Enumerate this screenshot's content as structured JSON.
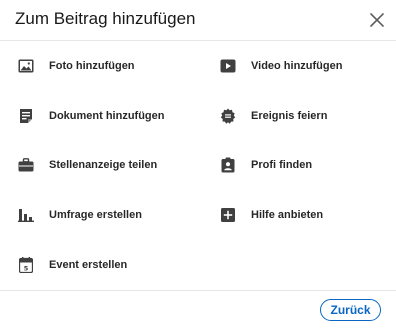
{
  "dialog": {
    "title": "Zum Beitrag hinzufügen",
    "close_icon": "close-icon"
  },
  "options": [
    {
      "label": "Foto hinzufügen",
      "icon": "photo-icon"
    },
    {
      "label": "Video hinzufügen",
      "icon": "video-icon"
    },
    {
      "label": "Dokument hinzufügen",
      "icon": "document-icon"
    },
    {
      "label": "Ereignis feiern",
      "icon": "celebration-icon"
    },
    {
      "label": "Stellenanzeige teilen",
      "icon": "briefcase-icon"
    },
    {
      "label": "Profi finden",
      "icon": "profile-badge-icon"
    },
    {
      "label": "Umfrage erstellen",
      "icon": "poll-icon"
    },
    {
      "label": "Hilfe anbieten",
      "icon": "help-plus-icon"
    },
    {
      "label": "Event erstellen",
      "icon": "calendar-icon"
    }
  ],
  "footer": {
    "back_label": "Zurück"
  },
  "colors": {
    "accent": "#0a66c2",
    "icon": "#404040",
    "divider": "#e6e6e6"
  }
}
